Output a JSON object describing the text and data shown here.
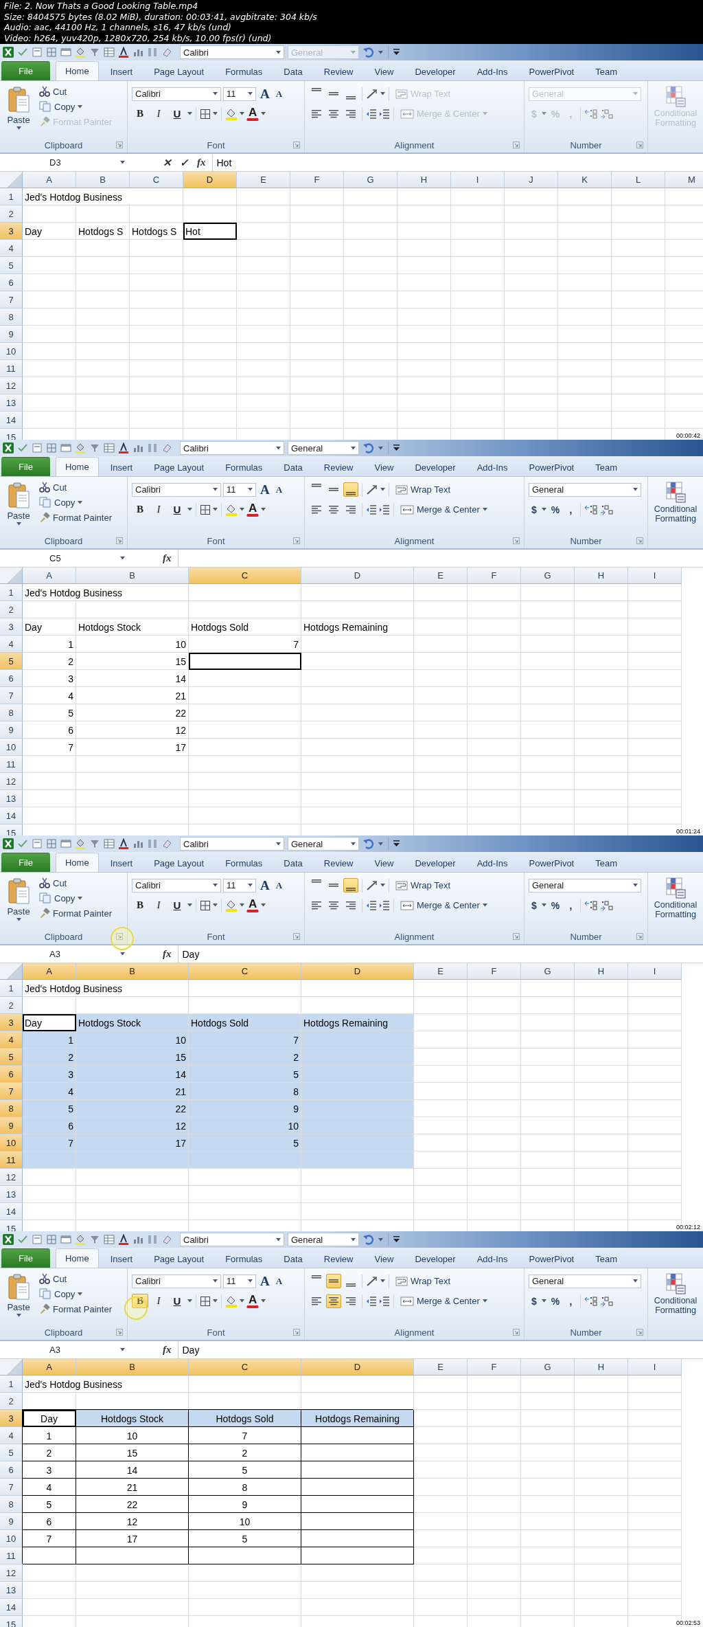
{
  "file_info": [
    "File: 2. Now Thats a Good Looking Table.mp4",
    "Size: 8404575 bytes (8.02 MiB), duration: 00:03:41, avgbitrate: 304 kb/s",
    "Audio: aac, 44100 Hz, 1 channels, s16, 47 kb/s (und)",
    "Video: h264, yuv420p, 1280x720, 254 kb/s, 10.00 fps(r) (und)"
  ],
  "frames": [
    {
      "qat": {
        "font": "Calibri",
        "number_format": "General"
      },
      "tabs": [
        {
          "label": "File",
          "selected": false
        },
        {
          "label": "Home",
          "selected": true
        },
        {
          "label": "Insert",
          "selected": false
        },
        {
          "label": "Page Layout",
          "selected": false
        },
        {
          "label": "Formulas",
          "selected": false
        },
        {
          "label": "Data",
          "selected": false
        },
        {
          "label": "Review",
          "selected": false
        },
        {
          "label": "View",
          "selected": false
        },
        {
          "label": "Developer",
          "selected": false
        },
        {
          "label": "Add-Ins",
          "selected": false
        },
        {
          "label": "PowerPivot",
          "selected": false
        },
        {
          "label": "Team",
          "selected": false
        }
      ],
      "ribbon": {
        "editing": true,
        "paste": "Paste",
        "cut": "Cut",
        "copy": "Copy",
        "format_painter": "Format Painter",
        "clipboard_label": "Clipboard",
        "font_name": "Calibri",
        "font_size": "11",
        "grow_font": "A",
        "shrink_font": "A",
        "font_buttons": [
          {
            "label": "B",
            "selected": false
          },
          {
            "label": "I",
            "selected": false
          },
          {
            "label": "U",
            "selected": false
          }
        ],
        "font_color": "A",
        "font_label": "Font",
        "vertical_align": [
          {
            "selected": false
          },
          {
            "selected": false
          },
          {
            "selected": false
          }
        ],
        "horizontal_align": [
          {
            "selected": false
          },
          {
            "selected": false
          },
          {
            "selected": false
          }
        ],
        "wrap_text": "Wrap Text",
        "merge": "Merge & Center",
        "alignment_label": "Alignment",
        "number_format": "General",
        "currency": "$",
        "percent": "%",
        "comma": ",",
        "number_label": "Number",
        "conditional": "Conditional Formatting"
      },
      "formula_bar": {
        "name_box": "D3",
        "buttons": [
          "✕",
          "✓",
          "fx"
        ],
        "formula": "Hot"
      },
      "columns": [
        {
          "label": "A",
          "selected": false
        },
        {
          "label": "B",
          "selected": false
        },
        {
          "label": "C",
          "selected": false
        },
        {
          "label": "D",
          "selected": true
        },
        {
          "label": "E",
          "selected": false
        },
        {
          "label": "F",
          "selected": false
        },
        {
          "label": "G",
          "selected": false
        },
        {
          "label": "H",
          "selected": false
        },
        {
          "label": "I",
          "selected": false
        },
        {
          "label": "J",
          "selected": false
        },
        {
          "label": "K",
          "selected": false
        },
        {
          "label": "L",
          "selected": false
        },
        {
          "label": "M",
          "selected": false
        }
      ],
      "rows": [
        {
          "label": "1",
          "selected": false,
          "cells": [
            {
              "text": "Jed's Hotdog Business",
              "kind": "text"
            }
          ]
        },
        {
          "label": "2",
          "selected": false
        },
        {
          "label": "3",
          "selected": true,
          "cells": [
            {
              "text": "Day",
              "kind": "text"
            },
            {
              "text": "Hotdogs S",
              "kind": "text"
            },
            {
              "text": "Hotdogs S",
              "kind": "text"
            },
            {
              "text": "Hot",
              "kind": "text",
              "active": true
            }
          ]
        },
        {
          "label": "4",
          "selected": false
        },
        {
          "label": "5",
          "selected": false
        },
        {
          "label": "6",
          "selected": false
        },
        {
          "label": "7",
          "selected": false
        },
        {
          "label": "8",
          "selected": false
        },
        {
          "label": "9",
          "selected": false
        },
        {
          "label": "10",
          "selected": false
        },
        {
          "label": "11",
          "selected": false
        },
        {
          "label": "12",
          "selected": false
        },
        {
          "label": "13",
          "selected": false
        },
        {
          "label": "14",
          "selected": false
        },
        {
          "label": "15",
          "selected": false
        }
      ],
      "timestamp": "00:00:42"
    },
    {
      "qat": {
        "font": "Calibri",
        "number_format": "General"
      },
      "tabs": [
        {
          "label": "File",
          "selected": false
        },
        {
          "label": "Home",
          "selected": true
        },
        {
          "label": "Insert",
          "selected": false
        },
        {
          "label": "Page Layout",
          "selected": false
        },
        {
          "label": "Formulas",
          "selected": false
        },
        {
          "label": "Data",
          "selected": false
        },
        {
          "label": "Review",
          "selected": false
        },
        {
          "label": "View",
          "selected": false
        },
        {
          "label": "Developer",
          "selected": false
        },
        {
          "label": "Add-Ins",
          "selected": false
        },
        {
          "label": "PowerPivot",
          "selected": false
        },
        {
          "label": "Team",
          "selected": false
        }
      ],
      "ribbon": {
        "editing": false,
        "paste": "Paste",
        "cut": "Cut",
        "copy": "Copy",
        "format_painter": "Format Painter",
        "clipboard_label": "Clipboard",
        "font_name": "Calibri",
        "font_size": "11",
        "grow_font": "A",
        "shrink_font": "A",
        "font_buttons": [
          {
            "label": "B",
            "selected": false
          },
          {
            "label": "I",
            "selected": false
          },
          {
            "label": "U",
            "selected": false
          }
        ],
        "font_color": "A",
        "font_label": "Font",
        "vertical_align": [
          {
            "selected": false
          },
          {
            "selected": false
          },
          {
            "selected": true
          }
        ],
        "horizontal_align": [
          {
            "selected": false
          },
          {
            "selected": false
          },
          {
            "selected": false
          }
        ],
        "wrap_text": "Wrap Text",
        "merge": "Merge & Center",
        "alignment_label": "Alignment",
        "number_format": "General",
        "currency": "$",
        "percent": "%",
        "comma": ",",
        "number_label": "Number",
        "conditional": "Conditional Formatting"
      },
      "formula_bar": {
        "name_box": "C5",
        "buttons": [
          "fx"
        ]
      },
      "columns": [
        {
          "label": "A",
          "selected": false
        },
        {
          "label": "B",
          "selected": false,
          "wide": true
        },
        {
          "label": "C",
          "selected": true,
          "wide": true
        },
        {
          "label": "D",
          "selected": false,
          "wide": true
        },
        {
          "label": "E",
          "selected": false
        },
        {
          "label": "F",
          "selected": false
        },
        {
          "label": "G",
          "selected": false
        },
        {
          "label": "H",
          "selected": false
        },
        {
          "label": "I",
          "selected": false
        }
      ],
      "rows": [
        {
          "label": "1",
          "selected": false,
          "cells": [
            {
              "text": "Jed's Hotdog Business",
              "kind": "text"
            }
          ]
        },
        {
          "label": "2",
          "selected": false
        },
        {
          "label": "3",
          "selected": false,
          "cells": [
            {
              "text": "Day",
              "kind": "text"
            },
            {
              "text": "Hotdogs Stock",
              "kind": "text"
            },
            {
              "text": "Hotdogs Sold",
              "kind": "text"
            },
            {
              "text": "Hotdogs Remaining",
              "kind": "text"
            }
          ]
        },
        {
          "label": "4",
          "selected": false,
          "cells": [
            {
              "text": "1",
              "kind": "number"
            },
            {
              "text": "10",
              "kind": "number"
            },
            {
              "text": "7",
              "kind": "number"
            }
          ]
        },
        {
          "label": "5",
          "selected": true,
          "cells": [
            {
              "text": "2",
              "kind": "number"
            },
            {
              "text": "15",
              "kind": "number"
            },
            {
              "active": true
            }
          ]
        },
        {
          "label": "6",
          "selected": false,
          "cells": [
            {
              "text": "3",
              "kind": "number"
            },
            {
              "text": "14",
              "kind": "number"
            }
          ]
        },
        {
          "label": "7",
          "selected": false,
          "cells": [
            {
              "text": "4",
              "kind": "number"
            },
            {
              "text": "21",
              "kind": "number"
            }
          ]
        },
        {
          "label": "8",
          "selected": false,
          "cells": [
            {
              "text": "5",
              "kind": "number"
            },
            {
              "text": "22",
              "kind": "number"
            }
          ]
        },
        {
          "label": "9",
          "selected": false,
          "cells": [
            {
              "text": "6",
              "kind": "number"
            },
            {
              "text": "12",
              "kind": "number"
            }
          ]
        },
        {
          "label": "10",
          "selected": false,
          "cells": [
            {
              "text": "7",
              "kind": "number"
            },
            {
              "text": "17",
              "kind": "number"
            }
          ]
        },
        {
          "label": "11",
          "selected": false
        },
        {
          "label": "12",
          "selected": false
        },
        {
          "label": "13",
          "selected": false
        },
        {
          "label": "14",
          "selected": false
        },
        {
          "label": "15",
          "selected": false
        }
      ],
      "timestamp": "00:01:24"
    },
    {
      "qat": {
        "font": "Calibri",
        "number_format": "General"
      },
      "tabs": [
        {
          "label": "File",
          "selected": false
        },
        {
          "label": "Home",
          "selected": true
        },
        {
          "label": "Insert",
          "selected": false
        },
        {
          "label": "Page Layout",
          "selected": false
        },
        {
          "label": "Formulas",
          "selected": false
        },
        {
          "label": "Data",
          "selected": false
        },
        {
          "label": "Review",
          "selected": false
        },
        {
          "label": "View",
          "selected": false
        },
        {
          "label": "Developer",
          "selected": false
        },
        {
          "label": "Add-Ins",
          "selected": false
        },
        {
          "label": "PowerPivot",
          "selected": false
        },
        {
          "label": "Team",
          "selected": false
        }
      ],
      "ribbon": {
        "editing": false,
        "paste": "Paste",
        "cut": "Cut",
        "copy": "Copy",
        "format_painter": "Format Painter",
        "clipboard_label": "Clipboard",
        "font_name": "Calibri",
        "font_size": "11",
        "grow_font": "A",
        "shrink_font": "A",
        "font_buttons": [
          {
            "label": "B",
            "selected": false
          },
          {
            "label": "I",
            "selected": false
          },
          {
            "label": "U",
            "selected": false
          }
        ],
        "font_color": "A",
        "font_label": "Font",
        "vertical_align": [
          {
            "selected": false
          },
          {
            "selected": false
          },
          {
            "selected": true
          }
        ],
        "horizontal_align": [
          {
            "selected": false
          },
          {
            "selected": false
          },
          {
            "selected": false
          }
        ],
        "wrap_text": "Wrap Text",
        "merge": "Merge & Center",
        "alignment_label": "Alignment",
        "number_format": "General",
        "currency": "$",
        "percent": "%",
        "comma": ",",
        "number_label": "Number",
        "conditional": "Conditional Formatting"
      },
      "formula_bar": {
        "name_box": "A3",
        "buttons": [
          "fx"
        ],
        "formula": "Day"
      },
      "columns": [
        {
          "label": "A",
          "selected": true
        },
        {
          "label": "B",
          "selected": true,
          "wide": true
        },
        {
          "label": "C",
          "selected": true,
          "wide": true
        },
        {
          "label": "D",
          "selected": true,
          "wide": true
        },
        {
          "label": "E",
          "selected": false
        },
        {
          "label": "F",
          "selected": false
        },
        {
          "label": "G",
          "selected": false
        },
        {
          "label": "H",
          "selected": false
        },
        {
          "label": "I",
          "selected": false
        }
      ],
      "rows": [
        {
          "label": "1",
          "selected": false,
          "cells": [
            {
              "text": "Jed's Hotdog Business",
              "kind": "text"
            }
          ]
        },
        {
          "label": "2",
          "selected": false
        },
        {
          "label": "3",
          "selected": true,
          "cells": [
            {
              "text": "Day",
              "kind": "text",
              "active": true
            },
            {
              "text": "Hotdogs Stock",
              "kind": "text",
              "selected": true
            },
            {
              "text": "Hotdogs Sold",
              "kind": "text",
              "selected": true
            },
            {
              "text": "Hotdogs Remaining",
              "kind": "text",
              "selected": true
            }
          ]
        },
        {
          "label": "4",
          "selected": true,
          "cells": [
            {
              "text": "1",
              "kind": "number",
              "selected": true
            },
            {
              "text": "10",
              "kind": "number",
              "selected": true
            },
            {
              "text": "7",
              "kind": "number",
              "selected": true
            },
            {
              "selected": true
            }
          ]
        },
        {
          "label": "5",
          "selected": true,
          "cells": [
            {
              "text": "2",
              "kind": "number",
              "selected": true
            },
            {
              "text": "15",
              "kind": "number",
              "selected": true
            },
            {
              "text": "2",
              "kind": "number",
              "selected": true
            },
            {
              "selected": true
            }
          ]
        },
        {
          "label": "6",
          "selected": true,
          "cells": [
            {
              "text": "3",
              "kind": "number",
              "selected": true
            },
            {
              "text": "14",
              "kind": "number",
              "selected": true
            },
            {
              "text": "5",
              "kind": "number",
              "selected": true
            },
            {
              "selected": true
            }
          ]
        },
        {
          "label": "7",
          "selected": true,
          "cells": [
            {
              "text": "4",
              "kind": "number",
              "selected": true
            },
            {
              "text": "21",
              "kind": "number",
              "selected": true
            },
            {
              "text": "8",
              "kind": "number",
              "selected": true
            },
            {
              "selected": true
            }
          ]
        },
        {
          "label": "8",
          "selected": true,
          "cells": [
            {
              "text": "5",
              "kind": "number",
              "selected": true
            },
            {
              "text": "22",
              "kind": "number",
              "selected": true
            },
            {
              "text": "9",
              "kind": "number",
              "selected": true
            },
            {
              "selected": true
            }
          ]
        },
        {
          "label": "9",
          "selected": true,
          "cells": [
            {
              "text": "6",
              "kind": "number",
              "selected": true
            },
            {
              "text": "12",
              "kind": "number",
              "selected": true
            },
            {
              "text": "10",
              "kind": "number",
              "selected": true
            },
            {
              "selected": true
            }
          ]
        },
        {
          "label": "10",
          "selected": true,
          "cells": [
            {
              "text": "7",
              "kind": "number",
              "selected": true
            },
            {
              "text": "17",
              "kind": "number",
              "selected": true
            },
            {
              "text": "5",
              "kind": "number",
              "selected": true
            },
            {
              "selected": true
            }
          ]
        },
        {
          "label": "11",
          "selected": true,
          "cells": [
            {
              "selected": true
            },
            {
              "selected": true
            },
            {
              "selected": true
            },
            {
              "selected": true
            }
          ]
        },
        {
          "label": "12",
          "selected": false
        },
        {
          "label": "13",
          "selected": false
        },
        {
          "label": "14",
          "selected": false
        },
        {
          "label": "15",
          "selected": false
        }
      ],
      "cursor": {
        "kind": "launcher"
      },
      "timestamp": "00:02:12"
    },
    {
      "qat": {
        "font": "Calibri",
        "number_format": "General"
      },
      "tabs": [
        {
          "label": "File",
          "selected": false
        },
        {
          "label": "Home",
          "selected": true
        },
        {
          "label": "Insert",
          "selected": false
        },
        {
          "label": "Page Layout",
          "selected": false
        },
        {
          "label": "Formulas",
          "selected": false
        },
        {
          "label": "Data",
          "selected": false
        },
        {
          "label": "Review",
          "selected": false
        },
        {
          "label": "View",
          "selected": false
        },
        {
          "label": "Developer",
          "selected": false
        },
        {
          "label": "Add-Ins",
          "selected": false
        },
        {
          "label": "PowerPivot",
          "selected": false
        },
        {
          "label": "Team",
          "selected": false
        }
      ],
      "ribbon": {
        "editing": false,
        "paste": "Paste",
        "cut": "Cut",
        "copy": "Copy",
        "format_painter": "Format Painter",
        "clipboard_label": "Clipboard",
        "font_name": "Calibri",
        "font_size": "11",
        "grow_font": "A",
        "shrink_font": "A",
        "font_buttons": [
          {
            "label": "B",
            "selected": true
          },
          {
            "label": "I",
            "selected": false
          },
          {
            "label": "U",
            "selected": false
          }
        ],
        "font_color": "A",
        "font_label": "Font",
        "vertical_align": [
          {
            "selected": false
          },
          {
            "selected": true
          },
          {
            "selected": false
          }
        ],
        "horizontal_align": [
          {
            "selected": false
          },
          {
            "selected": true
          },
          {
            "selected": false
          }
        ],
        "wrap_text": "Wrap Text",
        "merge": "Merge & Center",
        "alignment_label": "Alignment",
        "number_format": "General",
        "currency": "$",
        "percent": "%",
        "comma": ",",
        "number_label": "Number",
        "conditional": "Conditional Formatting"
      },
      "formula_bar": {
        "name_box": "A3",
        "buttons": [
          "fx"
        ],
        "formula": "Day"
      },
      "columns": [
        {
          "label": "A",
          "selected": true
        },
        {
          "label": "B",
          "selected": true,
          "wide": true
        },
        {
          "label": "C",
          "selected": true,
          "wide": true
        },
        {
          "label": "D",
          "selected": true,
          "wide": true
        },
        {
          "label": "E",
          "selected": false
        },
        {
          "label": "F",
          "selected": false
        },
        {
          "label": "G",
          "selected": false
        },
        {
          "label": "H",
          "selected": false
        },
        {
          "label": "I",
          "selected": false
        }
      ],
      "rows": [
        {
          "label": "1",
          "selected": false,
          "cells": [
            {
              "text": "Jed's Hotdog Business",
              "kind": "text"
            }
          ]
        },
        {
          "label": "2",
          "selected": false
        },
        {
          "label": "3",
          "selected": true,
          "cells": [
            {
              "text": "Day",
              "kind": "text",
              "centered": true,
              "active": true,
              "bordered": true
            },
            {
              "text": "Hotdogs Stock",
              "kind": "text",
              "centered": true,
              "selected": true,
              "bordered": true
            },
            {
              "text": "Hotdogs Sold",
              "kind": "text",
              "centered": true,
              "selected": true,
              "bordered": true
            },
            {
              "text": "Hotdogs Remaining",
              "kind": "text",
              "centered": true,
              "selected": true,
              "bordered": true
            }
          ]
        },
        {
          "label": "4",
          "selected": false,
          "cells": [
            {
              "text": "1",
              "kind": "number",
              "centered": true,
              "bordered": true
            },
            {
              "text": "10",
              "kind": "number",
              "centered": true,
              "bordered": true
            },
            {
              "text": "7",
              "kind": "number",
              "centered": true,
              "bordered": true
            },
            {
              "bordered": true
            }
          ]
        },
        {
          "label": "5",
          "selected": false,
          "cells": [
            {
              "text": "2",
              "kind": "number",
              "centered": true,
              "bordered": true
            },
            {
              "text": "15",
              "kind": "number",
              "centered": true,
              "bordered": true
            },
            {
              "text": "2",
              "kind": "number",
              "centered": true,
              "bordered": true
            },
            {
              "bordered": true
            }
          ]
        },
        {
          "label": "6",
          "selected": false,
          "cells": [
            {
              "text": "3",
              "kind": "number",
              "centered": true,
              "bordered": true
            },
            {
              "text": "14",
              "kind": "number",
              "centered": true,
              "bordered": true
            },
            {
              "text": "5",
              "kind": "number",
              "centered": true,
              "bordered": true
            },
            {
              "bordered": true
            }
          ]
        },
        {
          "label": "7",
          "selected": false,
          "cells": [
            {
              "text": "4",
              "kind": "number",
              "centered": true,
              "bordered": true
            },
            {
              "text": "21",
              "kind": "number",
              "centered": true,
              "bordered": true
            },
            {
              "text": "8",
              "kind": "number",
              "centered": true,
              "bordered": true
            },
            {
              "bordered": true
            }
          ]
        },
        {
          "label": "8",
          "selected": false,
          "cells": [
            {
              "text": "5",
              "kind": "number",
              "centered": true,
              "bordered": true
            },
            {
              "text": "22",
              "kind": "number",
              "centered": true,
              "bordered": true
            },
            {
              "text": "9",
              "kind": "number",
              "centered": true,
              "bordered": true
            },
            {
              "bordered": true
            }
          ]
        },
        {
          "label": "9",
          "selected": false,
          "cells": [
            {
              "text": "6",
              "kind": "number",
              "centered": true,
              "bordered": true
            },
            {
              "text": "12",
              "kind": "number",
              "centered": true,
              "bordered": true
            },
            {
              "text": "10",
              "kind": "number",
              "centered": true,
              "bordered": true
            },
            {
              "bordered": true
            }
          ]
        },
        {
          "label": "10",
          "selected": false,
          "cells": [
            {
              "text": "7",
              "kind": "number",
              "centered": true,
              "bordered": true
            },
            {
              "text": "17",
              "kind": "number",
              "centered": true,
              "bordered": true
            },
            {
              "text": "5",
              "kind": "number",
              "centered": true,
              "bordered": true
            },
            {
              "bordered": true
            }
          ]
        },
        {
          "label": "11",
          "selected": false,
          "cells": [
            {
              "bordered": true
            },
            {
              "bordered": true
            },
            {
              "bordered": true
            },
            {
              "bordered": true
            }
          ]
        },
        {
          "label": "12",
          "selected": false
        },
        {
          "label": "13",
          "selected": false
        },
        {
          "label": "14",
          "selected": false
        },
        {
          "label": "15",
          "selected": false
        }
      ],
      "cursor": {
        "kind": "bold"
      },
      "timestamp": "00:02:53"
    }
  ]
}
